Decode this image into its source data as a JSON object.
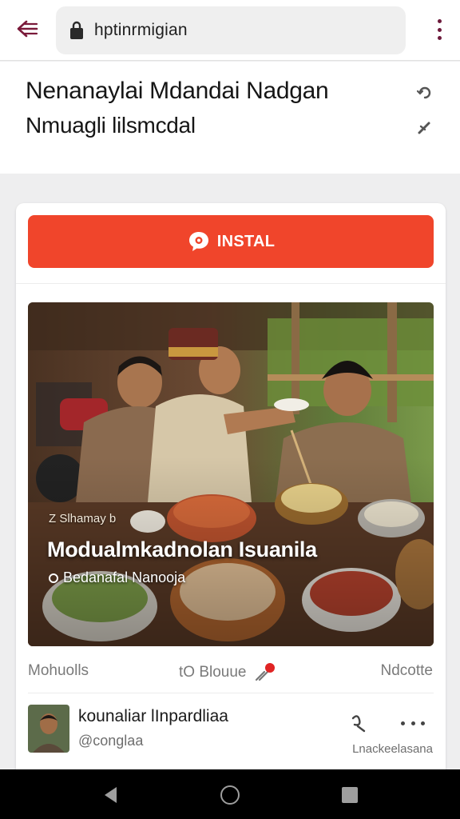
{
  "browser": {
    "url": "hptinrmigian",
    "back_icon": "back-arrow-icon",
    "lock_icon": "lock-icon",
    "menu_icon": "kebab-menu-icon",
    "accent_color": "#6d1a3c"
  },
  "header": {
    "title_line1": "Nenanaylai Mdandai Nadgan",
    "title_line2": "Nmuagli lilsmcdal"
  },
  "card": {
    "install_button": {
      "label": "INSTAL",
      "icon": "chat-bubble-icon",
      "color": "#f0452b"
    },
    "photo": {
      "overlay_small": "Z Slhamay b",
      "overlay_title": "Modualmkadnolan Isuanila",
      "overlay_subtitle": "Bedanafal Nanooja"
    },
    "stats": {
      "left": "Mohuolls",
      "middle": "tO Blouue",
      "right": "Ndcotte"
    },
    "author": {
      "name": "kounaliar lInpardliaa",
      "handle": "@conglaa",
      "meta": "Lnackeelasana"
    }
  }
}
